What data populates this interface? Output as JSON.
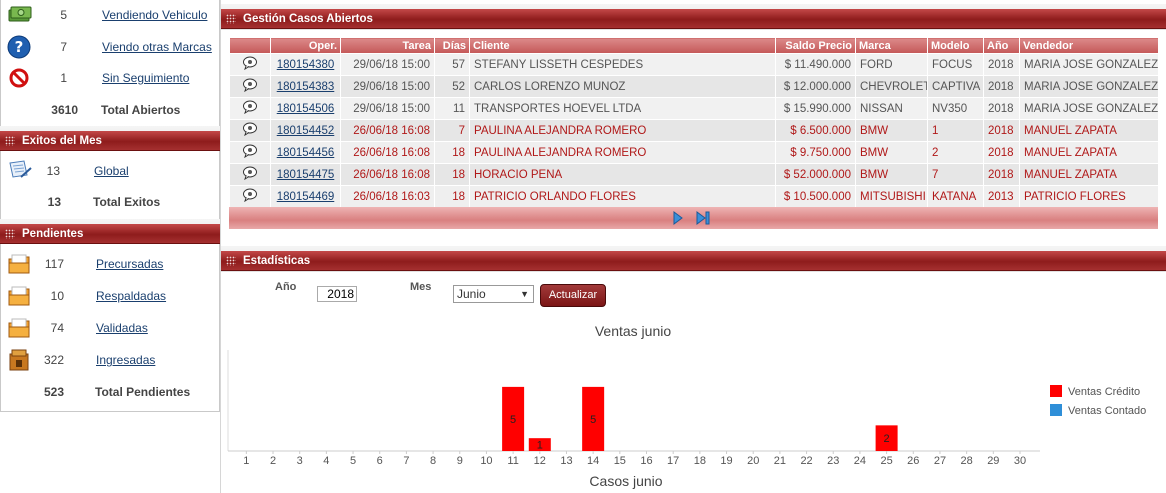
{
  "sidebar": {
    "top": [
      {
        "icon": "money-icon",
        "count": "5",
        "label": "Vendiendo Vehiculo"
      },
      {
        "icon": "question-icon",
        "count": "7",
        "label": "Viendo otras Marcas"
      },
      {
        "icon": "no-entry-icon",
        "count": "1",
        "label": "Sin Seguimiento"
      }
    ],
    "top_total": {
      "count": "3610",
      "label": "Total Abiertos"
    },
    "exitos": {
      "title": "Exitos del Mes",
      "items": [
        {
          "icon": "document-pen-icon",
          "count": "13",
          "label": "Global"
        }
      ],
      "total": {
        "count": "13",
        "label": "Total Exitos"
      }
    },
    "pendientes": {
      "title": "Pendientes",
      "items": [
        {
          "icon": "folder-icon",
          "count": "117",
          "label": "Precursadas"
        },
        {
          "icon": "folder-icon",
          "count": "10",
          "label": "Respaldadas"
        },
        {
          "icon": "folder-icon",
          "count": "74",
          "label": "Validadas"
        },
        {
          "icon": "folder-lock-icon",
          "count": "322",
          "label": "Ingresadas"
        }
      ],
      "total": {
        "count": "523",
        "label": "Total Pendientes"
      }
    }
  },
  "casos": {
    "title": "Gestión Casos Abiertos",
    "columns": [
      "",
      "Oper.",
      "Tarea",
      "Días",
      "Cliente",
      "Saldo Precio",
      "Marca",
      "Modelo",
      "Año",
      "Vendedor"
    ],
    "rows": [
      {
        "style": "norm",
        "oper": "180154380",
        "tarea": "29/06/18 15:00",
        "dias": "57",
        "cliente": "STEFANY LISSETH CESPEDES",
        "saldo": "$ 11.490.000",
        "marca": "FORD",
        "modelo": "FOCUS",
        "anio": "2018",
        "vendedor": "MARIA JOSE GONZALEZ"
      },
      {
        "style": "norm",
        "oper": "180154383",
        "tarea": "29/06/18 15:00",
        "dias": "52",
        "cliente": "CARLOS LORENZO MUNOZ",
        "saldo": "$ 12.000.000",
        "marca": "CHEVROLET",
        "modelo": "CAPTIVA",
        "anio": "2018",
        "vendedor": "MARIA JOSE GONZALEZ"
      },
      {
        "style": "norm",
        "oper": "180154506",
        "tarea": "29/06/18 15:00",
        "dias": "11",
        "cliente": "TRANSPORTES HOEVEL LTDA",
        "saldo": "$ 15.990.000",
        "marca": "NISSAN",
        "modelo": "NV350",
        "anio": "2018",
        "vendedor": "MARIA JOSE GONZALEZ"
      },
      {
        "style": "red",
        "oper": "180154452",
        "tarea": "26/06/18 16:08",
        "dias": "7",
        "cliente": "PAULINA ALEJANDRA ROMERO",
        "saldo": "$ 6.500.000",
        "marca": "BMW",
        "modelo": "1",
        "anio": "2018",
        "vendedor": "MANUEL ZAPATA"
      },
      {
        "style": "red",
        "oper": "180154456",
        "tarea": "26/06/18 16:08",
        "dias": "18",
        "cliente": "PAULINA ALEJANDRA ROMERO",
        "saldo": "$ 9.750.000",
        "marca": "BMW",
        "modelo": "2",
        "anio": "2018",
        "vendedor": "MANUEL ZAPATA"
      },
      {
        "style": "red",
        "oper": "180154475",
        "tarea": "26/06/18 16:08",
        "dias": "18",
        "cliente": "HORACIO PENA",
        "saldo": "$ 52.000.000",
        "marca": "BMW",
        "modelo": "7",
        "anio": "2018",
        "vendedor": "MANUEL ZAPATA"
      },
      {
        "style": "red",
        "oper": "180154469",
        "tarea": "26/06/18 16:03",
        "dias": "18",
        "cliente": "PATRICIO ORLANDO FLORES",
        "saldo": "$ 10.500.000",
        "marca": "MITSUBISHI",
        "modelo": "KATANA",
        "anio": "2013",
        "vendedor": "PATRICIO FLORES"
      }
    ]
  },
  "stats": {
    "title": "Estadísticas",
    "year_label": "Año",
    "year_value": "2018",
    "month_label": "Mes",
    "month_value": "Junio",
    "update_button": "Actualizar"
  },
  "colors": {
    "bar_red": "#ff0000",
    "contado_blue": "#2f8fd8",
    "header_red": "#9a2020"
  },
  "chart_data": {
    "type": "bar",
    "title": "Ventas junio",
    "xlabel": "Casos junio",
    "ylabel": "",
    "categories": [
      "1",
      "2",
      "3",
      "4",
      "5",
      "6",
      "7",
      "8",
      "9",
      "10",
      "11",
      "12",
      "13",
      "14",
      "15",
      "16",
      "17",
      "18",
      "19",
      "20",
      "21",
      "22",
      "23",
      "24",
      "25",
      "26",
      "27",
      "28",
      "29",
      "30"
    ],
    "series": [
      {
        "name": "Ventas Crédito",
        "values": [
          0,
          0,
          0,
          0,
          0,
          0,
          0,
          0,
          0,
          0,
          5,
          1,
          0,
          5,
          0,
          0,
          0,
          0,
          0,
          0,
          0,
          0,
          0,
          0,
          2,
          0,
          0,
          0,
          0,
          0
        ]
      },
      {
        "name": "Ventas Contado",
        "values": [
          0,
          0,
          0,
          0,
          0,
          0,
          0,
          0,
          0,
          0,
          0,
          0,
          0,
          0,
          0,
          0,
          0,
          0,
          0,
          0,
          0,
          0,
          0,
          0,
          0,
          0,
          0,
          0,
          0,
          0
        ]
      }
    ],
    "ylim": [
      0,
      7
    ],
    "grid": false,
    "legend": "right"
  }
}
